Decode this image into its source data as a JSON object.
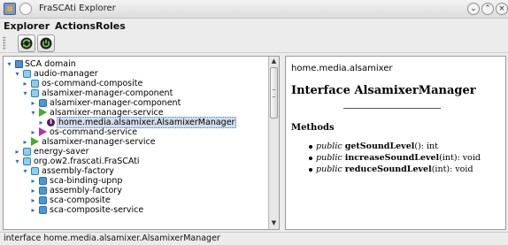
{
  "window": {
    "title": "FraSCAti Explorer"
  },
  "menu": {
    "items": [
      "Explorer",
      "Actions",
      "Roles"
    ]
  },
  "toolbar": {
    "buttons": [
      {
        "icon": "refresh-icon"
      },
      {
        "icon": "power-icon"
      }
    ]
  },
  "tree": {
    "rows": [
      {
        "label": "SCA domain",
        "icon": "domain-icon",
        "twisty": "expanded"
      },
      {
        "label": "audio-manager",
        "icon": "folder-icon",
        "twisty": "expanded"
      },
      {
        "label": "os-command-composite",
        "icon": "folder-icon",
        "twisty": "collapsed"
      },
      {
        "label": "alsamixer-manager-component",
        "icon": "folder-icon",
        "twisty": "expanded"
      },
      {
        "label": "alsamixer-manager-component",
        "icon": "component-icon",
        "twisty": "collapsed"
      },
      {
        "label": "alsamixer-manager-service",
        "icon": "service-icon",
        "twisty": "expanded"
      },
      {
        "label": "home.media.alsamixer.AlsamixerManager",
        "icon": "interface-icon",
        "twisty": "collapsed",
        "selected": true
      },
      {
        "label": "os-command-service",
        "icon": "reference-icon",
        "twisty": "collapsed"
      },
      {
        "label": "alsamixer-manager-service",
        "icon": "service-icon",
        "twisty": "collapsed"
      },
      {
        "label": "energy-saver",
        "icon": "folder-icon",
        "twisty": "collapsed"
      },
      {
        "label": "org.ow2.frascati.FraSCAti",
        "icon": "folder-icon",
        "twisty": "expanded"
      },
      {
        "label": "assembly-factory",
        "icon": "folder-icon",
        "twisty": "expanded"
      },
      {
        "label": "sca-binding-upnp",
        "icon": "component-icon",
        "twisty": "collapsed"
      },
      {
        "label": "assembly-factory",
        "icon": "component-icon",
        "twisty": "collapsed"
      },
      {
        "label": "sca-composite",
        "icon": "component-icon",
        "twisty": "collapsed"
      },
      {
        "label": "sca-composite-service",
        "icon": "component-icon",
        "twisty": "collapsed"
      }
    ]
  },
  "detail": {
    "path": "home.media.alsamixer",
    "title": "Interface AlsamixerManager",
    "methods_heading": "Methods",
    "methods": [
      {
        "modifier": "public",
        "name": "getSoundLevel",
        "params": "()",
        "returns": ": int"
      },
      {
        "modifier": "public",
        "name": "increaseSoundLevel",
        "params": "(int)",
        "returns": ": void"
      },
      {
        "modifier": "public",
        "name": "reduceSoundLevel",
        "params": "(int)",
        "returns": ": void"
      }
    ]
  },
  "status": {
    "text": "interface home.media.alsamixer.AlsamixerManager"
  }
}
